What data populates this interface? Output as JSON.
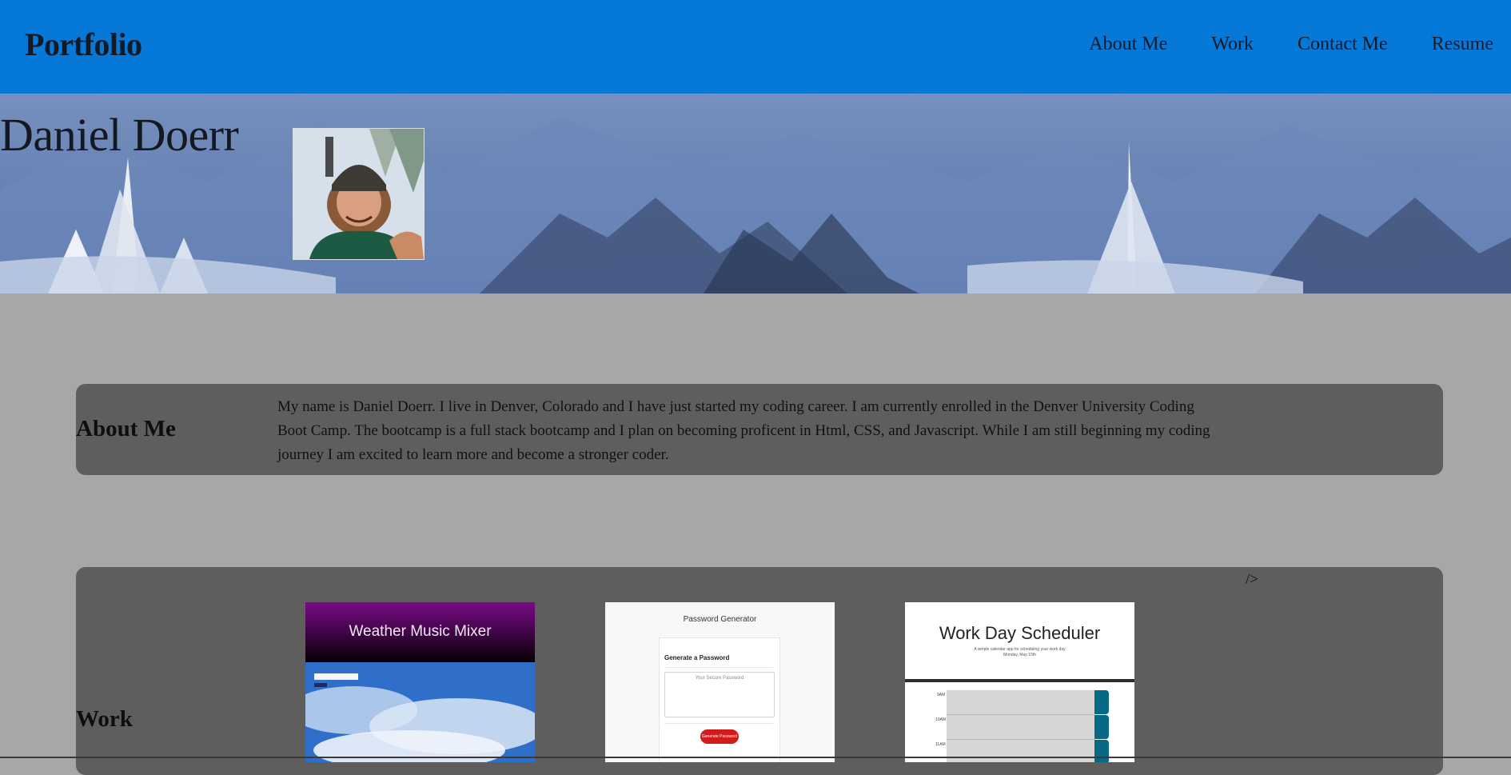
{
  "header": {
    "brand": "Portfolio",
    "nav": [
      "About Me",
      "Work",
      "Contact Me",
      "Resume"
    ]
  },
  "hero": {
    "name": "Daniel Doerr"
  },
  "about": {
    "title": "About Me",
    "text": "My name is Daniel Doerr. I live in Denver, Colorado and I have just started my coding career. I am currently enrolled in the Denver University Coding Boot Camp. The bootcamp is a full stack bootcamp and I plan on becoming proficent in Html, CSS, and Javascript. While I am still beginning my coding journey I am excited to learn more and become a stronger coder."
  },
  "work": {
    "title": "Work",
    "stray_text": "/>",
    "projects": [
      {
        "title": "Weather Music Mixer"
      },
      {
        "title": "Password Generator",
        "subtitle": "Generate a Password",
        "placeholder": "Your Secure Password",
        "button": "Generate Password"
      },
      {
        "title": "Work Day Scheduler",
        "subtitle": "A simple calendar app for scheduling your work day",
        "date": "Monday, May 10th",
        "hours": [
          "9AM",
          "10AM",
          "11AM"
        ]
      }
    ]
  },
  "colors": {
    "header_bg": "#0578d8",
    "page_bg": "#a7a7a7",
    "card_bg": "#5f5e5c",
    "hero_sky": "#5f7fb5"
  }
}
